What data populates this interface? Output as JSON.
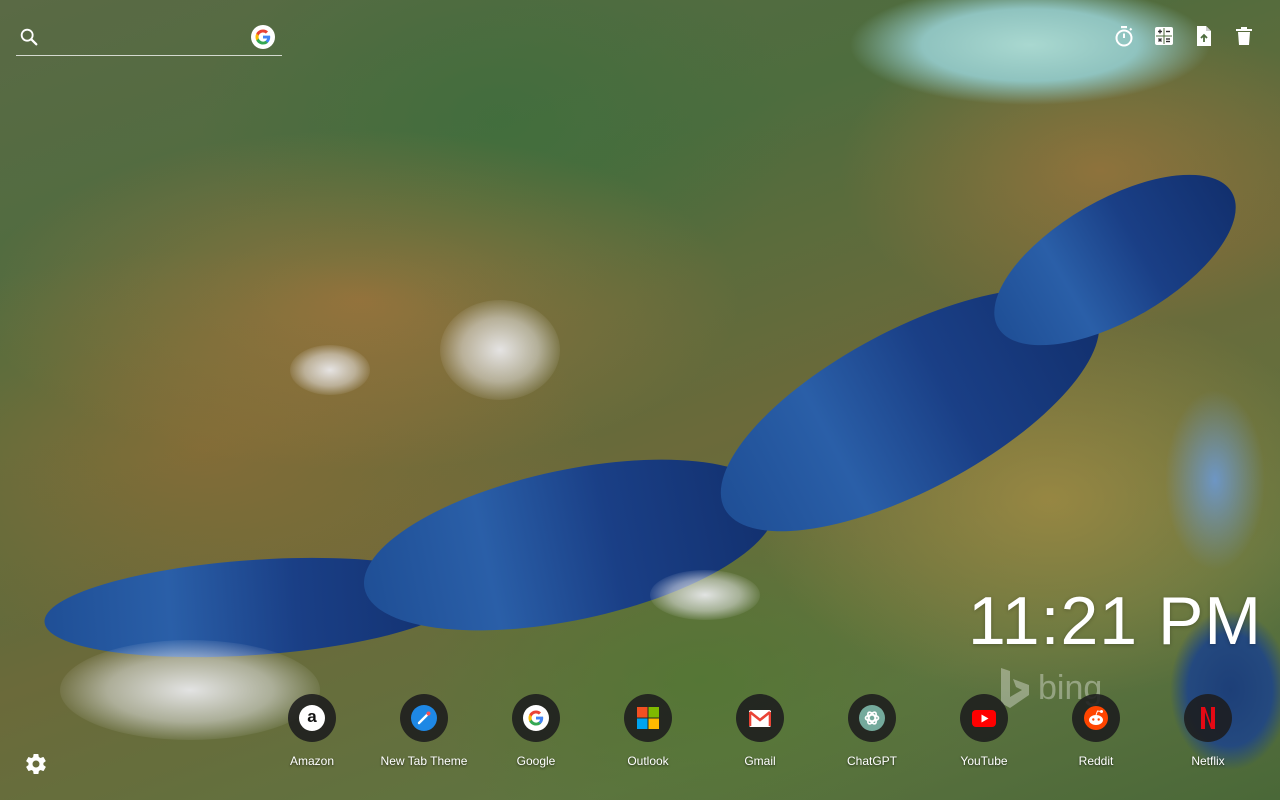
{
  "search": {
    "value": "",
    "placeholder": ""
  },
  "toolbar": {
    "items": [
      {
        "icon": "timer-icon"
      },
      {
        "icon": "calculator-icon"
      },
      {
        "icon": "file-export-icon"
      },
      {
        "icon": "trash-icon"
      }
    ]
  },
  "clock": {
    "time": "11:21 PM"
  },
  "branding": {
    "bing": "bing"
  },
  "shortcuts": [
    {
      "label": "Amazon",
      "icon": "amazon-icon",
      "glyph": "a",
      "color": "#111111"
    },
    {
      "label": "New Tab Theme",
      "icon": "new-tab-theme-icon",
      "glyph": "",
      "color": "#1e88e5"
    },
    {
      "label": "Google",
      "icon": "google-icon",
      "glyph": "G",
      "color": "#4285f4"
    },
    {
      "label": "Outlook",
      "icon": "microsoft-icon",
      "glyph": "",
      "color": "#f25022"
    },
    {
      "label": "Gmail",
      "icon": "gmail-icon",
      "glyph": "M",
      "color": "#ea4335"
    },
    {
      "label": "ChatGPT",
      "icon": "chatgpt-icon",
      "glyph": "",
      "color": "#74aa9c"
    },
    {
      "label": "YouTube",
      "icon": "youtube-icon",
      "glyph": "▶",
      "color": "#ff0000"
    },
    {
      "label": "Reddit",
      "icon": "reddit-icon",
      "glyph": "",
      "color": "#ff4500"
    },
    {
      "label": "Netflix",
      "icon": "netflix-icon",
      "glyph": "N",
      "color": "#e50914"
    }
  ]
}
